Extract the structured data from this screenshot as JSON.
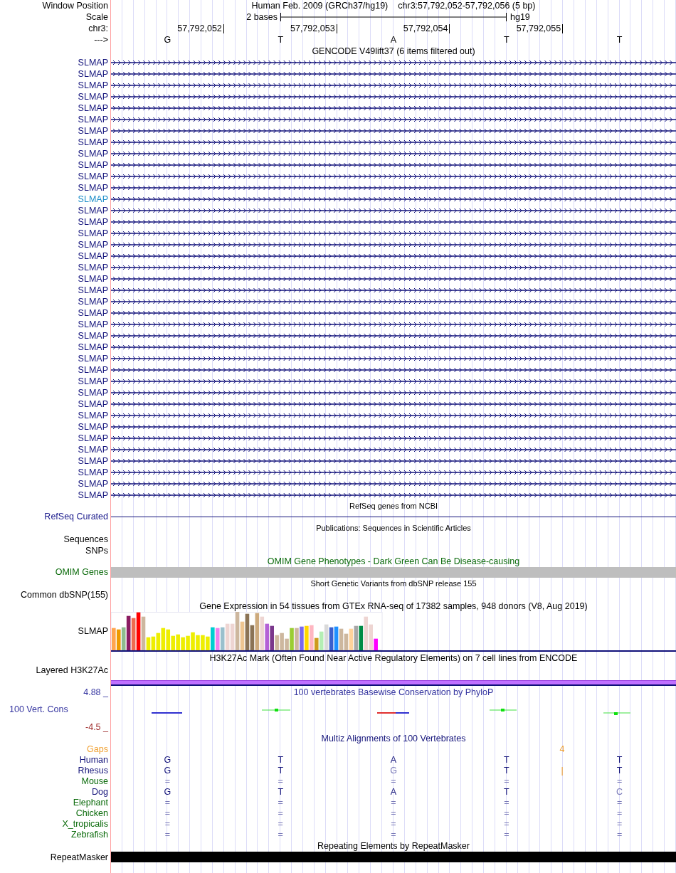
{
  "header": {
    "position": {
      "label": "Window Position",
      "assembly": "Human Feb. 2009 (GRCh37/hg19)",
      "range": "chr3:57,792,052-57,792,056 (5 bp)"
    },
    "scale": {
      "label": "Scale",
      "span": "2 bases",
      "db": "hg19"
    },
    "ruler": {
      "label": "chr3:",
      "ticks": [
        "57,792,052",
        "57,792,053",
        "57,792,054",
        "57,792,055"
      ]
    },
    "strand": {
      "label": "--->",
      "bases": [
        "G",
        "T",
        "A",
        "T",
        "T"
      ]
    }
  },
  "gencode": {
    "title": "GENCODE V49lift37 (6 items filtered out)",
    "items": [
      {
        "name": "SLMAP",
        "color": "#10107a"
      },
      {
        "name": "SLMAP",
        "color": "#10107a"
      },
      {
        "name": "SLMAP",
        "color": "#10107a"
      },
      {
        "name": "SLMAP",
        "color": "#10107a"
      },
      {
        "name": "SLMAP",
        "color": "#10107a"
      },
      {
        "name": "SLMAP",
        "color": "#10107a"
      },
      {
        "name": "SLMAP",
        "color": "#10107a"
      },
      {
        "name": "SLMAP",
        "color": "#10107a"
      },
      {
        "name": "SLMAP",
        "color": "#10107a"
      },
      {
        "name": "SLMAP",
        "color": "#10107a"
      },
      {
        "name": "SLMAP",
        "color": "#10107a"
      },
      {
        "name": "SLMAP",
        "color": "#10107a"
      },
      {
        "name": "SLMAP",
        "color": "#1a8cc8"
      },
      {
        "name": "SLMAP",
        "color": "#10107a"
      },
      {
        "name": "SLMAP",
        "color": "#10107a"
      },
      {
        "name": "SLMAP",
        "color": "#10107a"
      },
      {
        "name": "SLMAP",
        "color": "#10107a"
      },
      {
        "name": "SLMAP",
        "color": "#10107a"
      },
      {
        "name": "SLMAP",
        "color": "#10107a"
      },
      {
        "name": "SLMAP",
        "color": "#10107a"
      },
      {
        "name": "SLMAP",
        "color": "#10107a"
      },
      {
        "name": "SLMAP",
        "color": "#10107a"
      },
      {
        "name": "SLMAP",
        "color": "#10107a"
      },
      {
        "name": "SLMAP",
        "color": "#10107a"
      },
      {
        "name": "SLMAP",
        "color": "#10107a"
      },
      {
        "name": "SLMAP",
        "color": "#10107a"
      },
      {
        "name": "SLMAP",
        "color": "#10107a"
      },
      {
        "name": "SLMAP",
        "color": "#10107a"
      },
      {
        "name": "SLMAP",
        "color": "#10107a"
      },
      {
        "name": "SLMAP",
        "color": "#10107a"
      },
      {
        "name": "SLMAP",
        "color": "#10107a"
      },
      {
        "name": "SLMAP",
        "color": "#10107a"
      },
      {
        "name": "SLMAP",
        "color": "#10107a"
      },
      {
        "name": "SLMAP",
        "color": "#10107a"
      },
      {
        "name": "SLMAP",
        "color": "#10107a"
      },
      {
        "name": "SLMAP",
        "color": "#10107a"
      },
      {
        "name": "SLMAP",
        "color": "#10107a"
      },
      {
        "name": "SLMAP",
        "color": "#10107a"
      },
      {
        "name": "SLMAP",
        "color": "#10107a"
      }
    ]
  },
  "refseq": {
    "title": "RefSeq genes from NCBI",
    "label": "RefSeq Curated"
  },
  "publications": {
    "title": "Publications: Sequences in Scientific Articles",
    "labels": [
      "Sequences",
      "SNPs"
    ]
  },
  "omim": {
    "title": "OMIM Gene Phenotypes - Dark Green Can Be Disease-causing",
    "label": "OMIM Genes"
  },
  "dbsnp": {
    "title": "Short Genetic Variants from dbSNP release 155",
    "label": "Common dbSNP(155)"
  },
  "gtex": {
    "title": "Gene Expression in 54 tissues from GTEx RNA-seq of 17382 samples, 948 donors (V8, Aug 2019)",
    "label": "SLMAP"
  },
  "h3k27ac": {
    "title": "H3K27Ac Mark (Often Found Near Active Regulatory Elements) on 7 cell lines from ENCODE",
    "label": "Layered H3K27Ac"
  },
  "phylop": {
    "title": "100 vertebrates Basewise Conservation by PhyloP",
    "label": "100 Vert. Cons",
    "max": "4.88 _",
    "min": "-4.5 _"
  },
  "multiz": {
    "title": "Multiz Alignments of 100 Vertebrates",
    "rows": [
      {
        "name": "Gaps",
        "color": "#f0a030",
        "bases": [],
        "gap": "4"
      },
      {
        "name": "Human",
        "color": "#14147a",
        "bases": [
          {
            "text": "G",
            "dim": false
          },
          {
            "text": "T",
            "dim": false
          },
          {
            "text": "A",
            "dim": false
          },
          {
            "text": "T",
            "dim": false
          },
          {
            "text": "T",
            "dim": false
          }
        ]
      },
      {
        "name": "Rhesus",
        "color": "#14147a",
        "bases": [
          {
            "text": "G",
            "dim": false
          },
          {
            "text": "T",
            "dim": false
          },
          {
            "text": "G",
            "dim": true
          },
          {
            "text": "T",
            "dim": false
          },
          {
            "text": "T",
            "dim": false
          }
        ],
        "gap": "|"
      },
      {
        "name": "Mouse",
        "color": "#0a6a0a",
        "bases": [
          {
            "text": "=",
            "dim": true
          },
          {
            "text": "=",
            "dim": true
          },
          {
            "text": "=",
            "dim": true
          },
          {
            "text": "=",
            "dim": true
          },
          {
            "text": "=",
            "dim": true
          }
        ]
      },
      {
        "name": "Dog",
        "color": "#14147a",
        "bases": [
          {
            "text": "G",
            "dim": false
          },
          {
            "text": "T",
            "dim": false
          },
          {
            "text": "A",
            "dim": false
          },
          {
            "text": "T",
            "dim": false
          },
          {
            "text": "C",
            "dim": true
          }
        ]
      },
      {
        "name": "Elephant",
        "color": "#0a6a0a",
        "bases": [
          {
            "text": "=",
            "dim": true
          },
          {
            "text": "=",
            "dim": true
          },
          {
            "text": "=",
            "dim": true
          },
          {
            "text": "=",
            "dim": true
          },
          {
            "text": "=",
            "dim": true
          }
        ]
      },
      {
        "name": "Chicken",
        "color": "#0a6a0a",
        "bases": [
          {
            "text": "=",
            "dim": true
          },
          {
            "text": "=",
            "dim": true
          },
          {
            "text": "=",
            "dim": true
          },
          {
            "text": "=",
            "dim": true
          },
          {
            "text": "=",
            "dim": true
          }
        ]
      },
      {
        "name": "X_tropicalis",
        "color": "#0a6a0a",
        "bases": [
          {
            "text": "=",
            "dim": true
          },
          {
            "text": "=",
            "dim": true
          },
          {
            "text": "=",
            "dim": true
          },
          {
            "text": "=",
            "dim": true
          },
          {
            "text": "=",
            "dim": true
          }
        ]
      },
      {
        "name": "Zebrafish",
        "color": "#0a6a0a",
        "bases": [
          {
            "text": "=",
            "dim": true
          },
          {
            "text": "=",
            "dim": true
          },
          {
            "text": "=",
            "dim": true
          },
          {
            "text": "=",
            "dim": true
          },
          {
            "text": "=",
            "dim": true
          }
        ]
      }
    ]
  },
  "repeatmasker": {
    "title": "Repeating Elements by RepeatMasker",
    "label": "RepeatMasker"
  }
}
